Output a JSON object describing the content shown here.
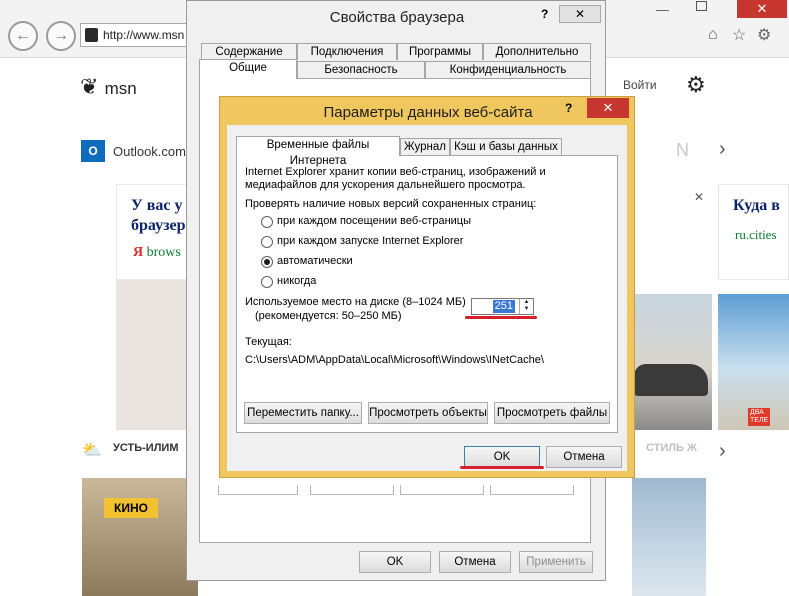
{
  "browser": {
    "address": "http://www.msn",
    "back_icon": "back-arrow-icon",
    "forward_icon": "forward-arrow-icon"
  },
  "msn": {
    "logo_text": "msn",
    "signin": "Войти",
    "outlook": "Outlook.com",
    "headline_left": [
      "У вас у",
      "браузер"
    ],
    "source_left": "brows",
    "headline_right": "Куда в",
    "source_right": "ru.cities",
    "weather_city": "УСТЬ-ИЛИМ",
    "kino_badge": "КИНО",
    "style_label": "СТИЛЬ Ж",
    "ad_text": [
      "ДВА",
      "ТЕЛЕ"
    ]
  },
  "browser_props": {
    "title": "Свойства браузера",
    "tabs_row1": [
      "Содержание",
      "Подключения",
      "Программы",
      "Дополнительно"
    ],
    "tabs_row2": [
      "Общие",
      "Безопасность",
      "Конфиденциальность"
    ],
    "ok": "OK",
    "cancel": "Отмена",
    "apply": "Применить"
  },
  "site_data": {
    "title": "Параметры данных веб-сайта",
    "help": "?",
    "tabs": [
      "Временные файлы Интернета",
      "Журнал",
      "Кэш и базы данных"
    ],
    "desc_line1": "Internet Explorer хранит копии веб-страниц, изображений и",
    "desc_line2": "медиафайлов для ускорения дальнейшего просмотра.",
    "check_label": "Проверять наличие новых версий сохраненных страниц:",
    "options": [
      "при каждом посещении веб-страницы",
      "при каждом запуске Internet Explorer",
      "автоматически",
      "никогда"
    ],
    "selected_index": 2,
    "disk_label_1": "Используемое место на диске (8–1024 МБ)",
    "disk_label_2": "(рекомендуется: 50–250 МБ)",
    "disk_value": "251",
    "current_label": "Текущая:",
    "current_path": "C:\\Users\\ADM\\AppData\\Local\\Microsoft\\Windows\\INetCache\\",
    "btn_move": "Переместить папку...",
    "btn_view_objects": "Просмотреть объекты",
    "btn_view_files": "Просмотреть файлы",
    "ok": "OK",
    "cancel": "Отмена"
  },
  "colors": {
    "accent_red": "#d6202b",
    "title_frame": "#f0c75e",
    "close_red": "#c7372f"
  }
}
